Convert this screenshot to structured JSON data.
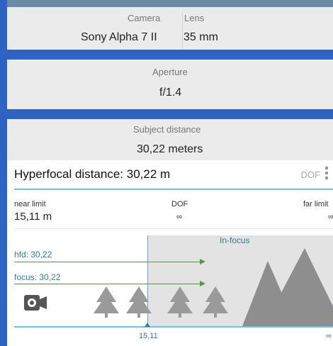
{
  "camera_panel": {
    "camera_label": "Camera",
    "camera_value": "Sony Alpha 7 II",
    "lens_label": "Lens",
    "lens_value": "35 mm"
  },
  "aperture_panel": {
    "label": "Aperture",
    "value": "f/1.4"
  },
  "subject_panel": {
    "label": "Subject distance",
    "value": "30,22 meters"
  },
  "result": {
    "hyperfocal_title": "Hyperfocal distance: 30,22 m",
    "dof_button": "DOF",
    "near_label": "near limit",
    "near_value": "15,11 m",
    "dof_label": "DOF",
    "dof_value": "∞",
    "far_label": "far limit",
    "far_value": "∞"
  },
  "diagram": {
    "in_focus_label": "In-focus",
    "hfd_label": "hfd: 30,22",
    "focus_label": "focus: 30,22",
    "near_tick": "15,11",
    "far_tick": "∞"
  },
  "colors": {
    "accent": "#6cc3e4",
    "arrow": "#4f9c3d",
    "label_blue": "#2f7d9b"
  }
}
